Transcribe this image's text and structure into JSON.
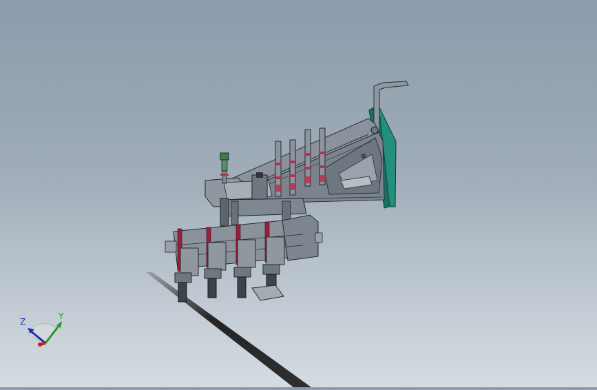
{
  "viewport": {
    "background_top": "#8b9bab",
    "background_bottom": "#d5dce2"
  },
  "model": {
    "machine_color": "#7d8590",
    "plate_color": "#22907d",
    "accent_color": "#9b1f3b",
    "fitting_green": "#3e7a4b"
  },
  "triad": {
    "z_label": "Z",
    "y_label": "Y",
    "z_color": "#1f2db3",
    "y_color": "#1f9a2a",
    "x_color": "#c8201e"
  }
}
